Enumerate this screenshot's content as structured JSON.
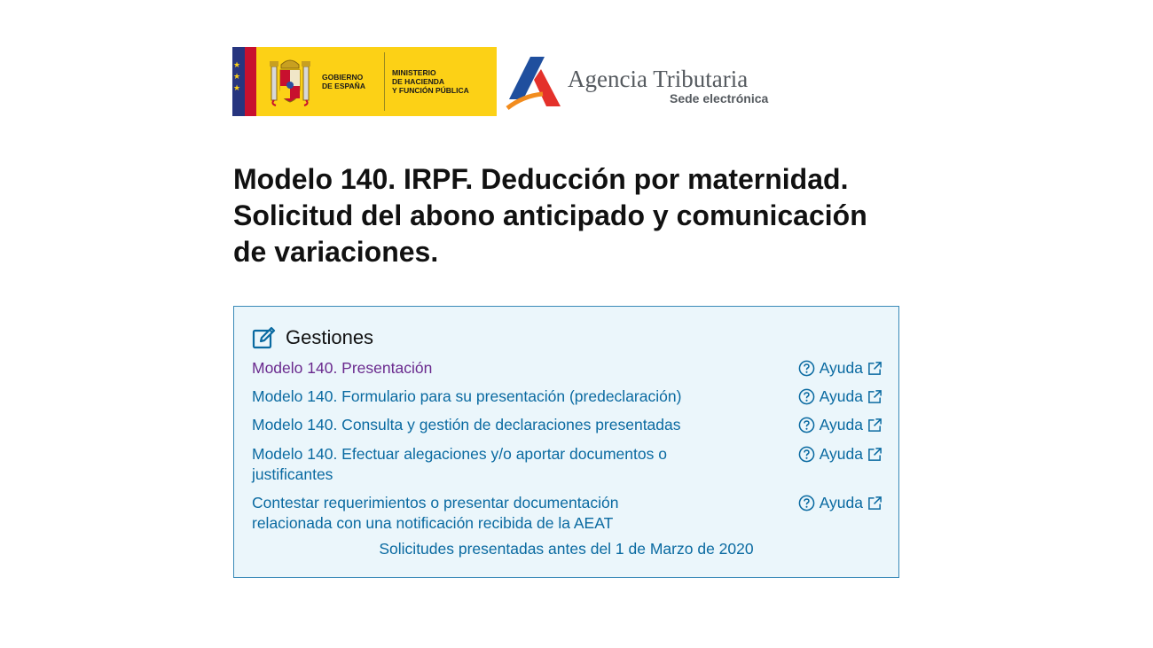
{
  "header": {
    "gov_line1": "GOBIERNO\nDE ESPAÑA",
    "ministry": "MINISTERIO\nDE HACIENDA\nY FUNCIÓN PÚBLICA",
    "agency_name": "Agencia Tributaria",
    "agency_sub": "Sede electrónica"
  },
  "page_title": "Modelo 140. IRPF. Deducción por maternidad. Solicitud del abono anticipado y comunicación de variaciones.",
  "panel": {
    "title": "Gestiones",
    "help_label": "Ayuda",
    "items": [
      {
        "label": "Modelo 140. Presentación",
        "visited": true
      },
      {
        "label": "Modelo 140. Formulario para su presentación (predeclaración)"
      },
      {
        "label": "Modelo 140. Consulta y gestión de declaraciones presentadas"
      },
      {
        "label": "Modelo 140. Efectuar alegaciones y/o aportar documentos o justificantes"
      },
      {
        "label": "Contestar requerimientos o presentar documentación relacionada con una notificación recibida de la AEAT"
      }
    ],
    "footer_link": "Solicitudes presentadas antes del 1 de Marzo de 2020"
  },
  "colors": {
    "link": "#0a6aa1",
    "visited_link": "#6a2a8e",
    "panel_bg": "#ebf6fb",
    "panel_border": "#3a8ab8",
    "gov_yellow": "#fcd116"
  }
}
